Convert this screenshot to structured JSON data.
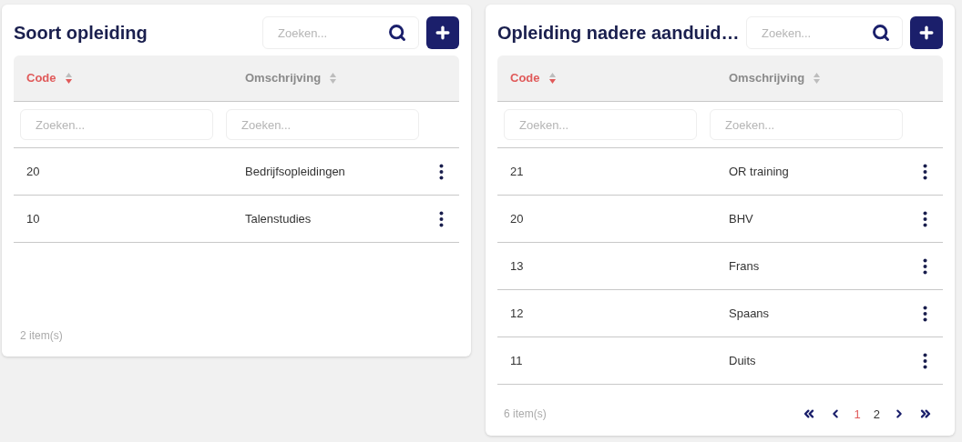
{
  "panels": [
    {
      "title": "Soort opleiding",
      "search": {
        "placeholder": "Zoeken..."
      },
      "columns": [
        {
          "label": "Code",
          "sorted": true,
          "filter_placeholder": "Zoeken..."
        },
        {
          "label": "Omschrijving",
          "sorted": false,
          "filter_placeholder": "Zoeken..."
        }
      ],
      "rows": [
        {
          "code": "20",
          "description": "Bedrijfsopleidingen"
        },
        {
          "code": "10",
          "description": "Talenstudies"
        }
      ],
      "count": "2 item(s)"
    },
    {
      "title": "Opleiding nadere aanduid…",
      "search": {
        "placeholder": "Zoeken..."
      },
      "columns": [
        {
          "label": "Code",
          "sorted": true,
          "filter_placeholder": "Zoeken..."
        },
        {
          "label": "Omschrijving",
          "sorted": false,
          "filter_placeholder": "Zoeken..."
        }
      ],
      "rows": [
        {
          "code": "21",
          "description": "OR training"
        },
        {
          "code": "20",
          "description": "BHV"
        },
        {
          "code": "13",
          "description": "Frans"
        },
        {
          "code": "12",
          "description": "Spaans"
        },
        {
          "code": "11",
          "description": "Duits"
        }
      ],
      "count": "6 item(s)",
      "pagination": {
        "pages": [
          {
            "label": "1",
            "selected": true
          },
          {
            "label": "2",
            "selected": false
          }
        ]
      }
    }
  ]
}
